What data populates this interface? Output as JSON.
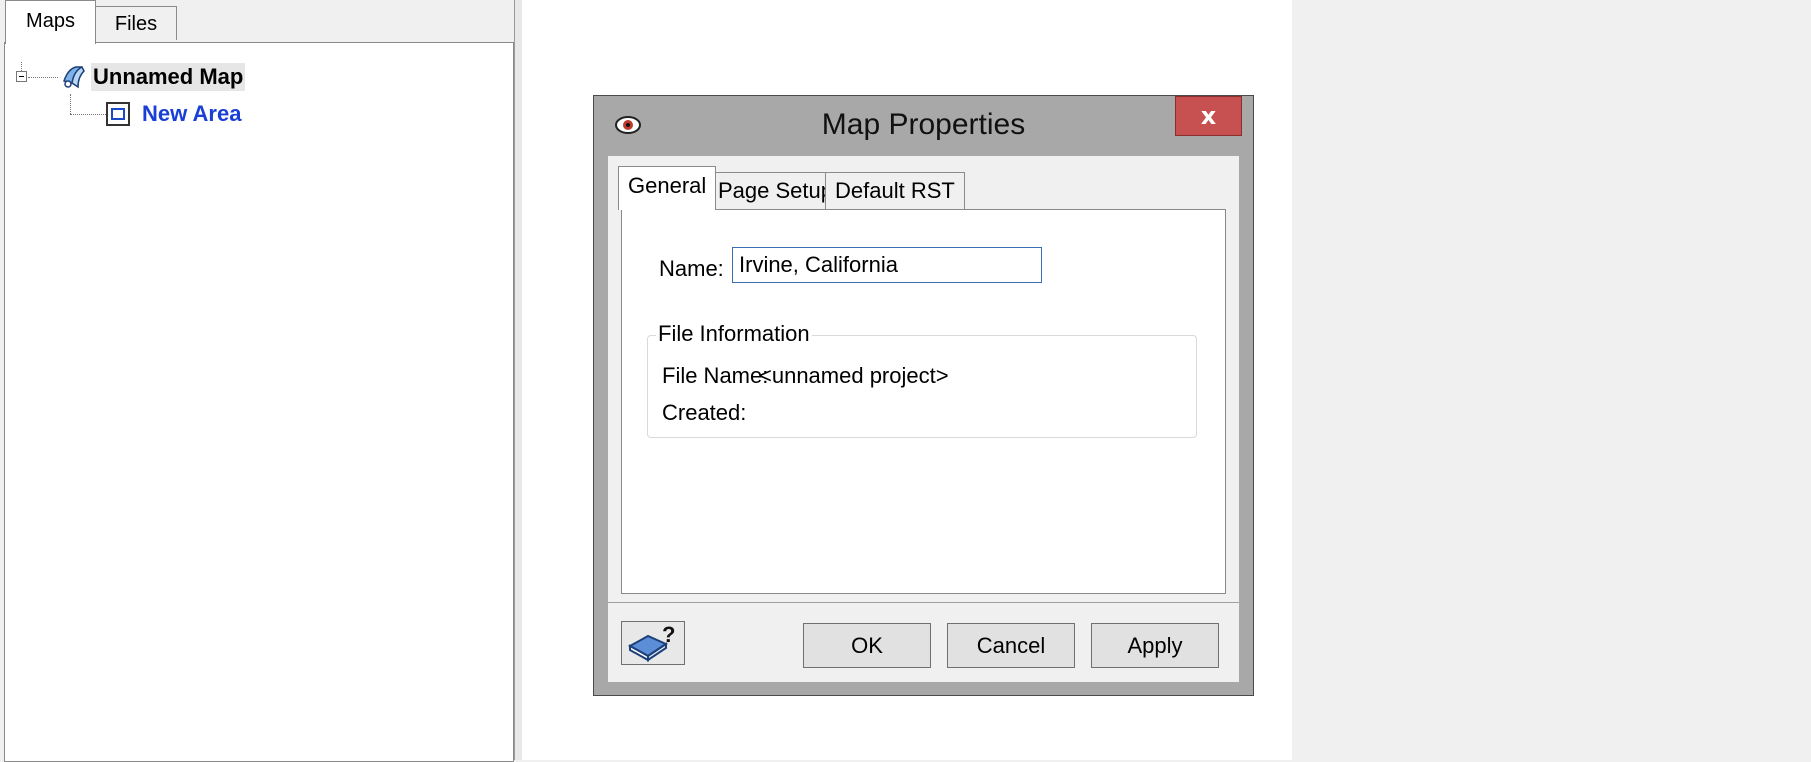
{
  "left_panel": {
    "tabs": [
      {
        "label": "Maps",
        "active": true
      },
      {
        "label": "Files",
        "active": false
      }
    ],
    "tree": {
      "root": {
        "label": "Unnamed Map",
        "icon": "map-icon",
        "expanded": true
      },
      "children": [
        {
          "label": "New Area",
          "icon": "area-icon",
          "color": "#1a3fd6"
        }
      ]
    }
  },
  "dialog": {
    "title": "Map Properties",
    "close_label": "x",
    "tabs": [
      {
        "label": "General",
        "active": true
      },
      {
        "label": "Page Setup",
        "active": false
      },
      {
        "label": "Default RST",
        "active": false
      }
    ],
    "general": {
      "name_label": "Name:",
      "name_value": "Irvine, California",
      "file_info": {
        "legend": "File Information",
        "file_name_label": "File Name:",
        "file_name_value": "<unnamed project>",
        "created_label": "Created:",
        "created_value": ""
      }
    },
    "buttons": {
      "ok": "OK",
      "cancel": "Cancel",
      "apply": "Apply"
    },
    "help_icon": "help-book-icon",
    "colors": {
      "close_bg": "#c75050",
      "frame": "#a8a8a8",
      "input_border": "#3c6eb4"
    }
  }
}
